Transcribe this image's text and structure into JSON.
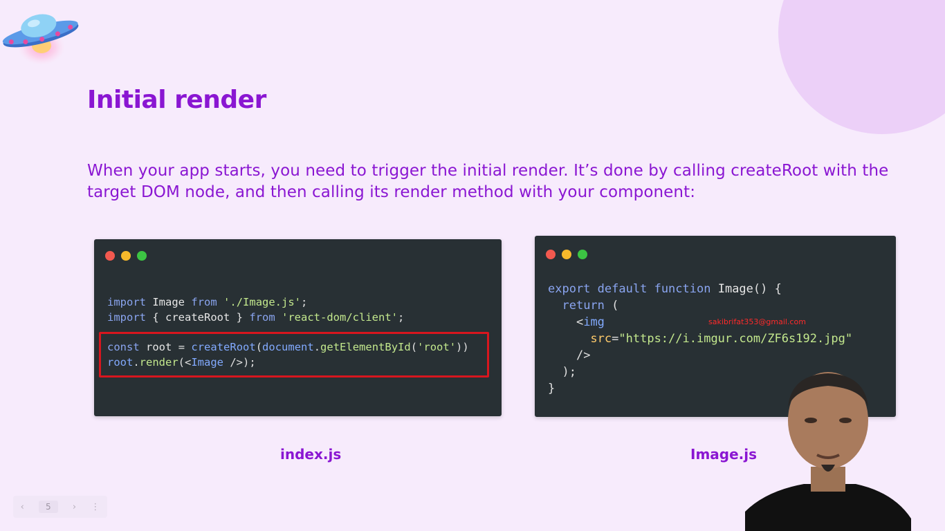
{
  "slide": {
    "title": "Initial render",
    "description": "When your app starts, you need to trigger the initial render. It’s done by calling createRoot with the target DOM node, and then calling its render method with your component:"
  },
  "code_index": {
    "caption": "index.js",
    "line1": {
      "kw1": "import",
      "name": "Image",
      "kw2": "from",
      "str": "'./Image.js'",
      "end": ";"
    },
    "line2": {
      "kw1": "import",
      "name": "{ createRoot }",
      "kw2": "from",
      "str": "'react-dom/client'",
      "end": ";"
    },
    "line3": {
      "kw": "const",
      "id": "root",
      "eq": "=",
      "fn": "createRoot",
      "p1": "(",
      "obj": "document",
      "dot": ".",
      "fn2": "getElementById",
      "p2": "(",
      "str": "'root'",
      "end": "))"
    },
    "line4": {
      "id": "root",
      "dot": ".",
      "fn": "render",
      "p1": "(<",
      "tag": "Image",
      "end": " />);"
    }
  },
  "code_image": {
    "caption": "Image.js",
    "line1": {
      "kw1": "export",
      "kw2": "default",
      "kw3": "function",
      "name": "Image",
      "end": "() {"
    },
    "line2": {
      "kw": "return",
      "end": " ("
    },
    "line3": {
      "open": "<",
      "tag": "img"
    },
    "line4": {
      "attr": "src",
      "eq": "=",
      "str": "\"https://i.imgur.com/ZF6s192.jpg\""
    },
    "line5": {
      "close": "/>"
    },
    "line6": {
      "text": ");"
    },
    "line7": {
      "text": "}"
    }
  },
  "watermark_email": "sakibrifat353@gmail.com",
  "slide_nav": {
    "prev": "‹",
    "page": "5",
    "next": "›",
    "more": "⋮"
  },
  "colors": {
    "background": "#f7ebfc",
    "accent": "#8a16d2",
    "code_bg": "#283034",
    "highlight": "#d8161e"
  },
  "icons": [
    "ufo-icon",
    "window-close-dot",
    "window-minimize-dot",
    "window-maximize-dot",
    "chevron-left-icon",
    "chevron-right-icon",
    "more-vertical-icon"
  ]
}
